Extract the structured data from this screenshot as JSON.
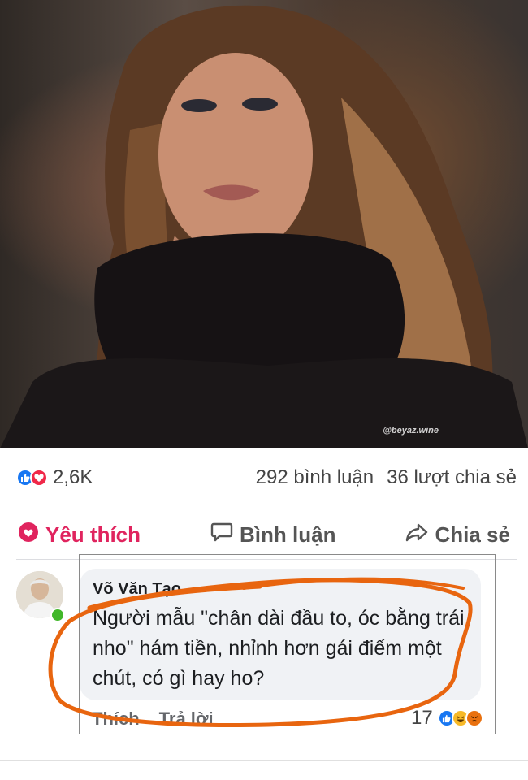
{
  "post": {
    "watermark": "@beyaz.wine"
  },
  "stats": {
    "reaction_count": "2,6K",
    "comments": "292 bình luận",
    "shares": "36 lượt chia sẻ"
  },
  "actions": {
    "like": "Yêu thích",
    "comment": "Bình luận",
    "share": "Chia sẻ"
  },
  "comment": {
    "author": "Võ Văn Tạo",
    "text": "Người mẫu \"chân dài đầu to, óc bằng trái nho\" hám tiền, nhỉnh hơn gái điếm một chút, có gì hay ho?",
    "like_label": "Thích",
    "reply_label": "Trả lời",
    "reaction_count": "17"
  },
  "colors": {
    "like_blue": "#1877f2",
    "love_red": "#f02849",
    "highlight_orange": "#e8650f",
    "online_green": "#42b72a"
  },
  "icons": [
    "like-reaction-icon",
    "love-reaction-icon",
    "heart-icon",
    "speech-bubble-icon",
    "share-arrow-icon",
    "haha-reaction-icon",
    "angry-reaction-icon"
  ]
}
